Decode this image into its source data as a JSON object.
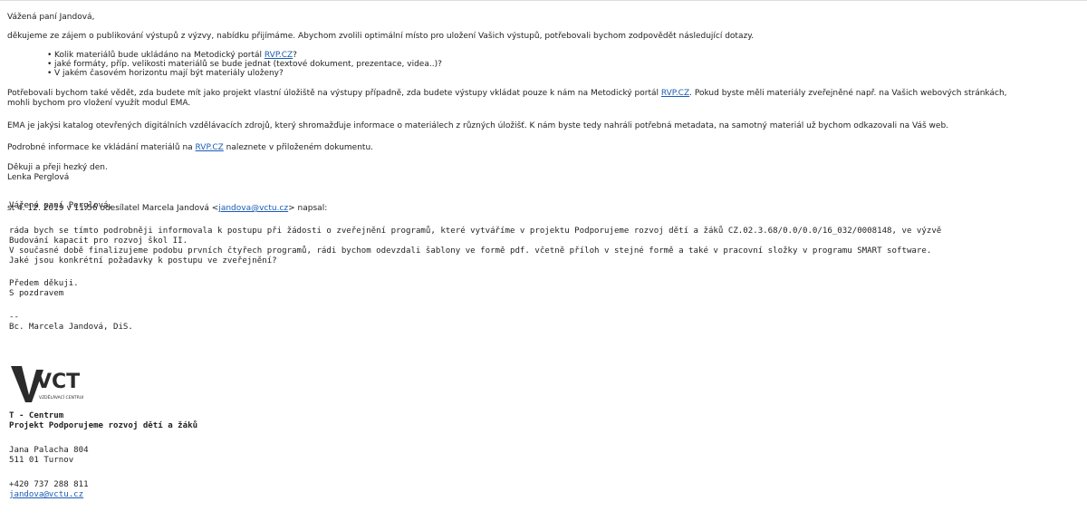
{
  "reply": {
    "greeting": "Vážená paní Jandová,",
    "intro": "děkujeme ze zájem o publikování výstupů z výzvy, nabídku přijímáme. Abychom zvolili optimální místo pro uložení Vašich výstupů, potřebovali bychom zodpovědět následující dotazy.",
    "bullets": [
      {
        "pre": "Kolik materiálů bude ukládáno na Metodický portál ",
        "link": "RVP.CZ",
        "post": "?"
      },
      {
        "pre": "jaké formáty, příp. velikosti materiálů se bude jednat (textové dokument, prezentace, videa..)?",
        "link": "",
        "post": ""
      },
      {
        "pre": "V jakém časovém horizontu mají být materiály uloženy?",
        "link": "",
        "post": ""
      }
    ],
    "para1_pre": "Potřebovali bychom také vědět, zda budete mít jako projekt vlastní úložiště na výstupy případně, zda budete výstupy vkládat pouze k nám na Metodický portál ",
    "para1_link": "RVP.CZ",
    "para1_post": ". Pokud  byste měli materiály zveřejněné např. na Vašich webových stránkách,",
    "para1_line2": "mohli bychom pro vložení využít modul EMA.",
    "para2": "EMA je jakýsi katalog otevřených digitálních vzdělávacích zdrojů, který shromažďuje informace o materiálech z různých úložišť. K nám byste tedy nahráli potřebná metadata, na samotný materiál už bychom odkazovali na Váš web.",
    "para3_pre": "Podrobné informace ke vkládání materiálů na ",
    "para3_link": "RVP.CZ",
    "para3_post": " naleznete v přiloženém dokumentu.",
    "closing": "Děkuji a přeji hezký den.",
    "signature": "Lenka Perglová"
  },
  "quote_header": {
    "pre": "st 4. 12. 2019 v 11:56 odesílatel Marcela Jandová <",
    "email": "jandova@vctu.cz",
    "post": "> napsal:"
  },
  "quoted": {
    "greeting": "Vážená paní Perglová,",
    "line1": "ráda bych se tímto podrobněji informovala k postupu při žádosti o zveřejnění programů, které vytváříme v projektu Podporujeme rozvoj dětí a žáků CZ.02.3.68/0.0/0.0/16_032/0008148, ve výzvě",
    "line2": "Budování kapacit pro rozvoj škol II.",
    "line3": "V současné době finalizujeme podobu prvních čtyřech programů, rádi bychom odevzdali šablony ve formě pdf. včetně příloh v stejné formě a také v pracovní složky v programu SMART software.",
    "line4": "Jaké jsou konkrétní požadavky k postupu ve zveřejnění?",
    "thanks": "Předem děkuji.",
    "regards": "S pozdravem",
    "dashes": "--",
    "name": "Bc. Marcela Jandová, DiS.",
    "logo_text": "VCT",
    "logo_sub": "VZDĚLÁVACÍ CENTRUM",
    "org": "T - Centrum",
    "project": "Projekt Podporujeme rozvoj dětí a žáků",
    "street": "Jana Palacha 804",
    "city": "511 01 Turnov",
    "phone": "+420 737 288 811",
    "email": "jandova@vctu.cz"
  },
  "colors": {
    "link": "#1a5bb5",
    "text": "#222222",
    "logo": "#2b2b2b"
  }
}
